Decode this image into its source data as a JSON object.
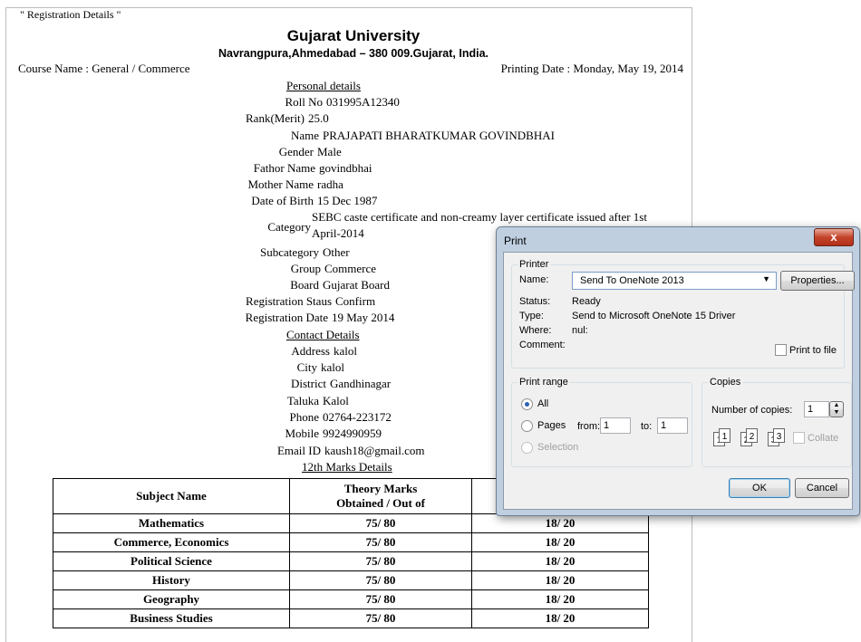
{
  "fieldset_legend": "\" Registration Details \"",
  "university": {
    "name": "Gujarat University",
    "address": "Navrangpura,Ahmedabad – 380 009.Gujarat, India."
  },
  "course": "Course Name : General / Commerce",
  "printing_date": "Printing Date : Monday, May 19, 2014",
  "personal": {
    "heading": "Personal details",
    "roll_label": "Roll No",
    "roll": "031995A12340",
    "rank_label": "Rank(Merit)",
    "rank": "25.0",
    "name_label": "Name",
    "name": "PRAJAPATI BHARATKUMAR GOVINDBHAI",
    "gender_label": "Gender",
    "gender": "Male",
    "father_label": "Fathor Name",
    "father": "govindbhai",
    "mother_label": "Mother Name",
    "mother": "radha",
    "dob_label": "Date of Birth",
    "dob": "15 Dec 1987",
    "category_label": "Category",
    "category_line1": "SEBC caste certificate and non-creamy layer certificate issued after 1st",
    "category_line2": "April-2014",
    "subcategory_label": "Subcategory",
    "subcategory": "Other",
    "group_label": "Group",
    "group": "Commerce",
    "board_label": "Board",
    "board": "Gujarat Board",
    "status_label": "Registration Staus",
    "status": "Confirm",
    "regdate_label": "Registration Date",
    "regdate": "19 May 2014"
  },
  "contact": {
    "heading": "Contact Details",
    "address_label": "Address",
    "address": "kalol",
    "city_label": "City",
    "city": "kalol",
    "district_label": "District",
    "district": "Gandhinagar",
    "taluka_label": "Taluka",
    "taluka": "Kalol",
    "phone_label": "Phone",
    "phone": "02764-223172",
    "mobile_label": "Mobile",
    "mobile": "9924990959",
    "email_label": "Email ID",
    "email": "kaush18@gmail.com"
  },
  "marks": {
    "heading": "12th Marks Details",
    "col_subject": "Subject Name",
    "col_theory_1": "Theory Marks",
    "col_theory_2": "Obtained / Out of",
    "rows": [
      {
        "subject": "Mathematics",
        "theory": "75/ 80",
        "practical": "18/ 20"
      },
      {
        "subject": "Commerce, Economics",
        "theory": "75/ 80",
        "practical": "18/ 20"
      },
      {
        "subject": "Political Science",
        "theory": "75/ 80",
        "practical": "18/ 20"
      },
      {
        "subject": "History",
        "theory": "75/ 80",
        "practical": "18/ 20"
      },
      {
        "subject": "Geography",
        "theory": "75/ 80",
        "practical": "18/ 20"
      },
      {
        "subject": "Business Studies",
        "theory": "75/ 80",
        "practical": "18/ 20"
      }
    ]
  },
  "print_dialog": {
    "title": "Print",
    "close": "x",
    "printer_group": "Printer",
    "name_label": "Name:",
    "printer_name": "Send To OneNote 2013",
    "properties": "Properties...",
    "status_label": "Status:",
    "status": "Ready",
    "type_label": "Type:",
    "type": "Send to Microsoft OneNote 15 Driver",
    "where_label": "Where:",
    "where": "nul:",
    "comment_label": "Comment:",
    "print_to_file": "Print to file",
    "range_group": "Print range",
    "all": "All",
    "pages": "Pages",
    "from_label": "from:",
    "from": "1",
    "to_label": "to:",
    "to": "1",
    "selection": "Selection",
    "copies_group": "Copies",
    "copies_label": "Number of copies:",
    "copies": "1",
    "collate": "Collate",
    "ok": "OK",
    "cancel": "Cancel"
  }
}
